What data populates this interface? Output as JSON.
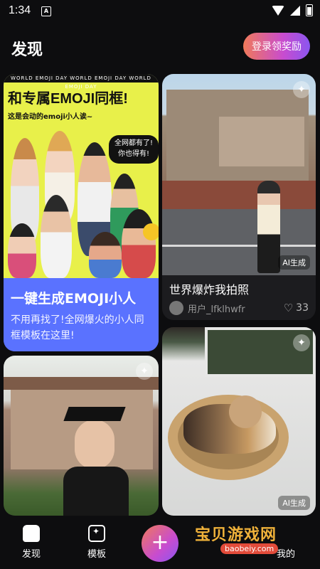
{
  "status_bar": {
    "time": "1:34",
    "app_badge": "A"
  },
  "header": {
    "title": "发现",
    "login_button": "登录领奖励"
  },
  "feed": {
    "card1": {
      "poster_banner": "WORLD EMOJI DAY  WORLD EMOJI DAY  WORLD EMOJI DAY",
      "poster_headline": "和专属EMOJI同框!",
      "poster_sub": "这是会动的emoji小人诶~",
      "poster_bubble_line1": "全网都有了!",
      "poster_bubble_line2": "你也得有!",
      "title": "一键生成EMOJI小人",
      "description": "不用再找了!全网爆火的小人同框模板在这里!"
    },
    "card2": {
      "ai_badge": "AI生成",
      "title": "世界爆炸我拍照",
      "user": "用户_lfklhwfr",
      "likes": "33"
    },
    "card3": {},
    "card4": {
      "ai_badge": "AI生成"
    }
  },
  "bottom_nav": {
    "discover": "发现",
    "template": "模板",
    "create": "+",
    "mine": "我的"
  },
  "watermark": {
    "text": "宝贝游戏网",
    "url": "baobeiy.com"
  },
  "colors": {
    "accent_gradient_start": "#f07a5a",
    "accent_gradient_end": "#8a56f0",
    "card_blue": "#5a72ff",
    "background": "#0d0d0f"
  }
}
